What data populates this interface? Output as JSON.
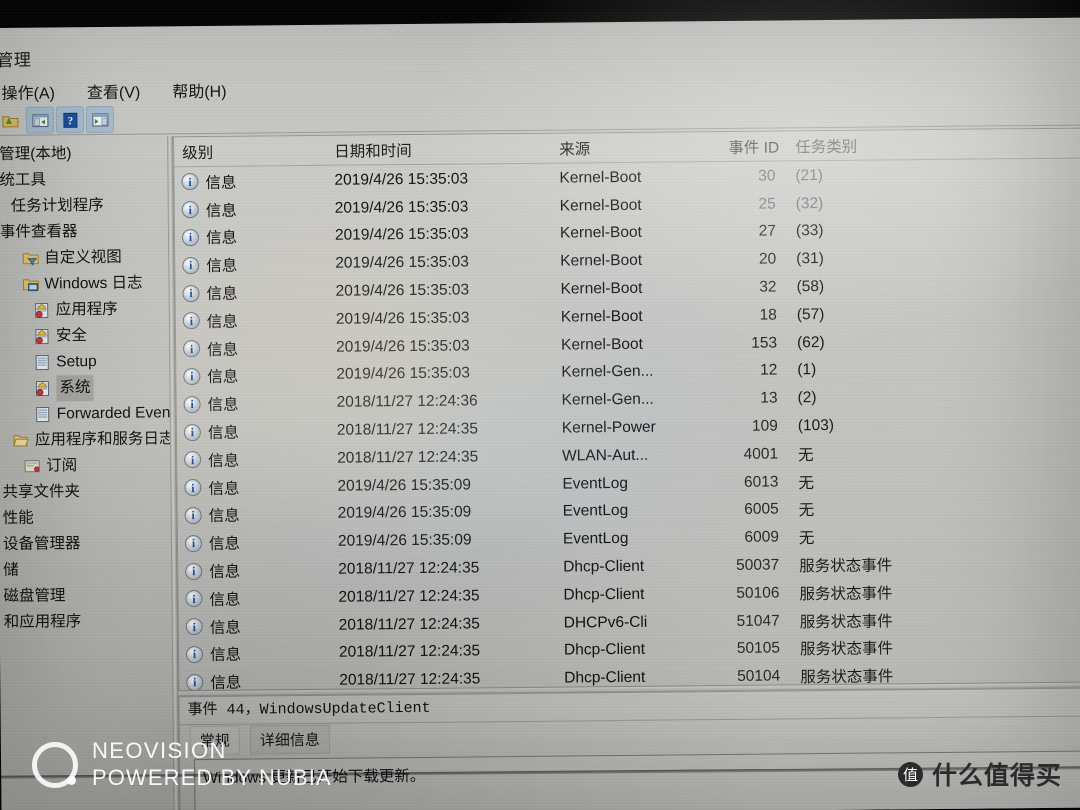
{
  "window": {
    "title": "管理",
    "menus": [
      {
        "label": "操作(A)"
      },
      {
        "label": "查看(V)"
      },
      {
        "label": "帮助(H)"
      }
    ],
    "toolbar": [
      {
        "name": "up-folder-icon",
        "tip": "向上"
      },
      {
        "name": "show-hide-console-tree-icon",
        "tip": "显示/隐藏控制台树"
      },
      {
        "name": "help-icon",
        "tip": "帮助"
      },
      {
        "name": "show-hide-action-pane-icon",
        "tip": "显示/隐藏操作窗格"
      }
    ]
  },
  "sidebar": {
    "items": [
      {
        "label": "管理(本地)",
        "indent": 0,
        "icon": "none",
        "selected": false
      },
      {
        "label": "统工具",
        "indent": 0,
        "icon": "none",
        "selected": false
      },
      {
        "label": "任务计划程序",
        "indent": 1,
        "icon": "none",
        "selected": false
      },
      {
        "label": "事件查看器",
        "indent": 0,
        "icon": "none",
        "selected": false
      },
      {
        "label": "自定义视图",
        "indent": 2,
        "icon": "folder-filter-icon",
        "selected": false
      },
      {
        "label": "Windows 日志",
        "indent": 2,
        "icon": "folder-log-icon",
        "selected": false
      },
      {
        "label": "应用程序",
        "indent": 3,
        "icon": "log-warning-icon",
        "selected": false
      },
      {
        "label": "安全",
        "indent": 3,
        "icon": "log-warning-icon",
        "selected": false
      },
      {
        "label": "Setup",
        "indent": 3,
        "icon": "log-plain-icon",
        "selected": false
      },
      {
        "label": "系统",
        "indent": 3,
        "icon": "log-warning-icon",
        "selected": true
      },
      {
        "label": "Forwarded Even",
        "indent": 3,
        "icon": "log-plain-icon",
        "selected": false
      },
      {
        "label": "应用程序和服务日志",
        "indent": 1,
        "icon": "folder-open-icon",
        "selected": false
      },
      {
        "label": "订阅",
        "indent": 2,
        "icon": "subscription-icon",
        "selected": false
      },
      {
        "label": "共享文件夹",
        "indent": 0,
        "icon": "none",
        "selected": false
      },
      {
        "label": "性能",
        "indent": 0,
        "icon": "none",
        "selected": false
      },
      {
        "label": "设备管理器",
        "indent": 0,
        "icon": "none",
        "selected": false
      },
      {
        "label": "储",
        "indent": 0,
        "icon": "none",
        "selected": false
      },
      {
        "label": "磁盘管理",
        "indent": 0,
        "icon": "none",
        "selected": false
      },
      {
        "label": "和应用程序",
        "indent": 0,
        "icon": "none",
        "selected": false
      }
    ]
  },
  "list": {
    "columns": [
      {
        "key": "level",
        "label": "级别"
      },
      {
        "key": "datetime",
        "label": "日期和时间"
      },
      {
        "key": "source",
        "label": "来源"
      },
      {
        "key": "event_id",
        "label": "事件 ID"
      },
      {
        "key": "task_category",
        "label": "任务类别"
      }
    ],
    "rows": [
      {
        "level": "信息",
        "datetime": "2019/4/26 15:35:03",
        "source": "Kernel-Boot",
        "event_id": "30",
        "task_category": "(21)"
      },
      {
        "level": "信息",
        "datetime": "2019/4/26 15:35:03",
        "source": "Kernel-Boot",
        "event_id": "25",
        "task_category": "(32)"
      },
      {
        "level": "信息",
        "datetime": "2019/4/26 15:35:03",
        "source": "Kernel-Boot",
        "event_id": "27",
        "task_category": "(33)"
      },
      {
        "level": "信息",
        "datetime": "2019/4/26 15:35:03",
        "source": "Kernel-Boot",
        "event_id": "20",
        "task_category": "(31)"
      },
      {
        "level": "信息",
        "datetime": "2019/4/26 15:35:03",
        "source": "Kernel-Boot",
        "event_id": "32",
        "task_category": "(58)"
      },
      {
        "level": "信息",
        "datetime": "2019/4/26 15:35:03",
        "source": "Kernel-Boot",
        "event_id": "18",
        "task_category": "(57)"
      },
      {
        "level": "信息",
        "datetime": "2019/4/26 15:35:03",
        "source": "Kernel-Boot",
        "event_id": "153",
        "task_category": "(62)"
      },
      {
        "level": "信息",
        "datetime": "2019/4/26 15:35:03",
        "source": "Kernel-Gen...",
        "event_id": "12",
        "task_category": "(1)"
      },
      {
        "level": "信息",
        "datetime": "2018/11/27 12:24:36",
        "source": "Kernel-Gen...",
        "event_id": "13",
        "task_category": "(2)"
      },
      {
        "level": "信息",
        "datetime": "2018/11/27 12:24:35",
        "source": "Kernel-Power",
        "event_id": "109",
        "task_category": "(103)"
      },
      {
        "level": "信息",
        "datetime": "2018/11/27 12:24:35",
        "source": "WLAN-Aut...",
        "event_id": "4001",
        "task_category": "无"
      },
      {
        "level": "信息",
        "datetime": "2019/4/26 15:35:09",
        "source": "EventLog",
        "event_id": "6013",
        "task_category": "无"
      },
      {
        "level": "信息",
        "datetime": "2019/4/26 15:35:09",
        "source": "EventLog",
        "event_id": "6005",
        "task_category": "无"
      },
      {
        "level": "信息",
        "datetime": "2019/4/26 15:35:09",
        "source": "EventLog",
        "event_id": "6009",
        "task_category": "无"
      },
      {
        "level": "信息",
        "datetime": "2018/11/27 12:24:35",
        "source": "Dhcp-Client",
        "event_id": "50037",
        "task_category": "服务状态事件"
      },
      {
        "level": "信息",
        "datetime": "2018/11/27 12:24:35",
        "source": "Dhcp-Client",
        "event_id": "50106",
        "task_category": "服务状态事件"
      },
      {
        "level": "信息",
        "datetime": "2018/11/27 12:24:35",
        "source": "DHCPv6-Cli",
        "event_id": "51047",
        "task_category": "服务状态事件"
      },
      {
        "level": "信息",
        "datetime": "2018/11/27 12:24:35",
        "source": "Dhcp-Client",
        "event_id": "50105",
        "task_category": "服务状态事件"
      },
      {
        "level": "信息",
        "datetime": "2018/11/27 12:24:35",
        "source": "Dhcp-Client",
        "event_id": "50104",
        "task_category": "服务状态事件"
      }
    ]
  },
  "detail": {
    "title": "事件 44，WindowsUpdateClient",
    "tabs": [
      {
        "label": "常规",
        "active": true
      },
      {
        "label": "详细信息",
        "active": false
      }
    ],
    "body": "Windows 更新已开始下载更新。"
  },
  "watermarks": {
    "neovision_line1": "NEOVISION",
    "neovision_line2": "POWERED BY NUBIA",
    "smzdm_badge": "值",
    "smzdm_text": "什么值得买"
  }
}
